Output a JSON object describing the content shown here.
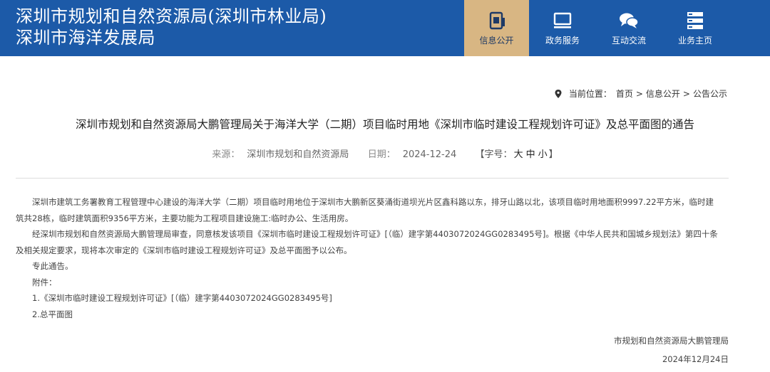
{
  "header": {
    "org_line1": "深圳市规划和自然资源局(深圳市林业局)",
    "org_line2": "深圳市海洋发展局",
    "nav": [
      {
        "label": "信息公开",
        "icon": "info-disclosure-icon",
        "active": true
      },
      {
        "label": "政务服务",
        "icon": "monitor-icon",
        "active": false
      },
      {
        "label": "互动交流",
        "icon": "chat-bubbles-icon",
        "active": false
      },
      {
        "label": "业务主页",
        "icon": "server-list-icon",
        "active": false
      }
    ]
  },
  "breadcrumb": {
    "prefix": "当前位置：",
    "items": [
      "首页",
      "信息公开",
      "公告公示"
    ],
    "sep": ">"
  },
  "article": {
    "title": "深圳市规划和自然资源局大鹏管理局关于海洋大学（二期）项目临时用地《深圳市临时建设工程规划许可证》及总平面图的通告",
    "source_label": "来源：",
    "source": "深圳市规划和自然资源局",
    "date_label": "日期：",
    "date": "2024-12-24",
    "fontsize_label": "【字号：",
    "fontsize_large": "大",
    "fontsize_medium": "中",
    "fontsize_small": "小",
    "fontsize_end": "】",
    "paragraphs": [
      "深圳市建筑工务署教育工程管理中心建设的海洋大学（二期）项目临时用地位于深圳市大鹏新区葵涌街道坝光片区鑫科路以东，排牙山路以北，该项目临时用地面积9997.22平方米，临时建筑共28栋，临时建筑面积9356平方米，主要功能为工程项目建设施工:临时办公、生活用房。",
      "经深圳市规划和自然资源局大鹏管理局审查，同意核发该项目《深圳市临时建设工程规划许可证》[（临）建字第4403072024GG0283495号]。根据《中华人民共和国城乡规划法》第四十条及相关规定要求，现将本次审定的《深圳市临时建设工程规划许可证》及总平面图予以公布。",
      "专此通告。",
      "附件：",
      "1.《深圳市临时建设工程规划许可证》[（临）建字第4403072024GG0283495号]",
      "2.总平面图"
    ],
    "signature": "市规划和自然资源局大鹏管理局",
    "sign_date": "2024年12月24日"
  }
}
